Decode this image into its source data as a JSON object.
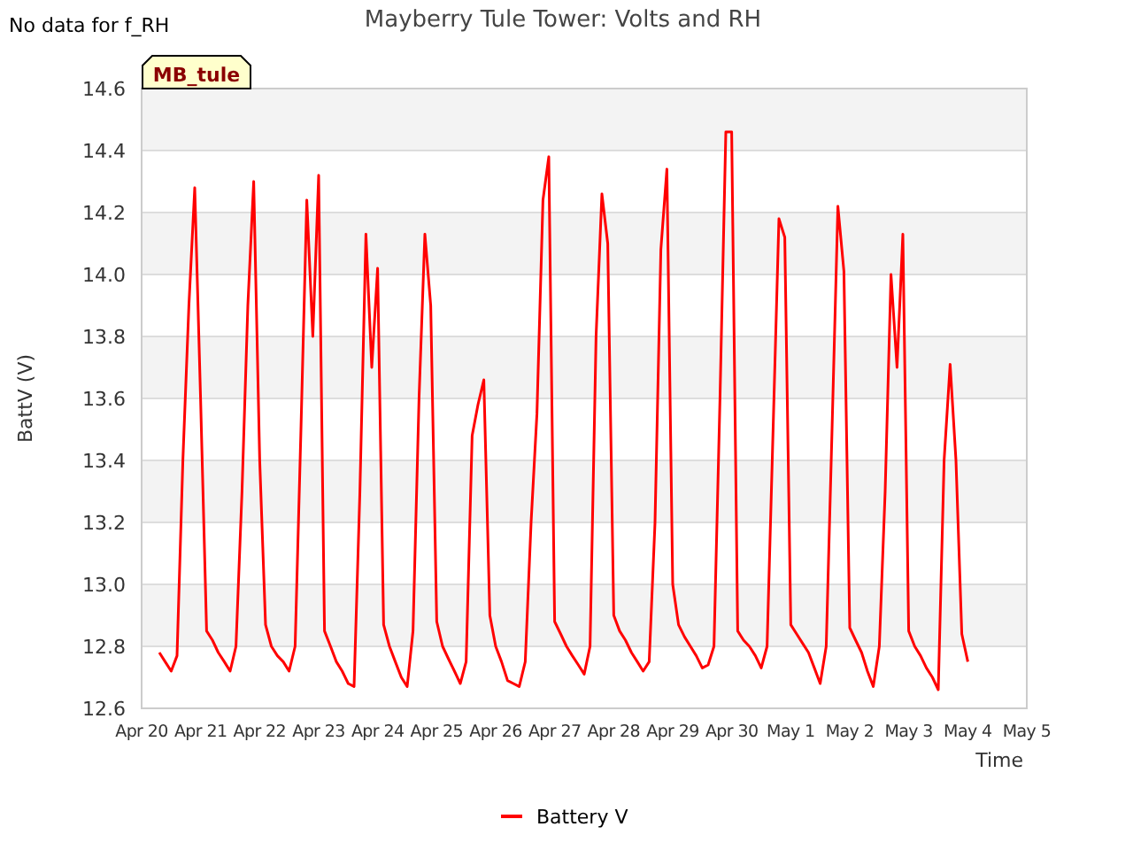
{
  "note": "No data for f_RH",
  "site_tag": "MB_tule",
  "chart_data": {
    "type": "line",
    "title": "Mayberry Tule Tower: Volts and RH",
    "xlabel": "Time",
    "ylabel": "BattV (V)",
    "categories": [
      "Apr 20",
      null,
      null,
      null,
      null,
      null,
      null,
      null,
      null,
      null,
      "Apr 21",
      null,
      null,
      null,
      null,
      null,
      null,
      null,
      null,
      null,
      "Apr 22",
      null,
      null,
      null,
      null,
      null,
      null,
      null,
      null,
      null,
      "Apr 23",
      null,
      null,
      null,
      null,
      null,
      null,
      null,
      null,
      null,
      "Apr 24",
      null,
      null,
      null,
      null,
      null,
      null,
      null,
      null,
      null,
      "Apr 25",
      null,
      null,
      null,
      null,
      null,
      null,
      null,
      null,
      null,
      "Apr 26",
      null,
      null,
      null,
      null,
      null,
      null,
      null,
      null,
      null,
      "Apr 27",
      null,
      null,
      null,
      null,
      null,
      null,
      null,
      null,
      null,
      "Apr 28",
      null,
      null,
      null,
      null,
      null,
      null,
      null,
      null,
      null,
      "Apr 29",
      null,
      null,
      null,
      null,
      null,
      null,
      null,
      null,
      null,
      "Apr 30",
      null,
      null,
      null,
      null,
      null,
      null,
      null,
      null,
      null,
      "May 1",
      null,
      null,
      null,
      null,
      null,
      null,
      null,
      null,
      null,
      "May 2",
      null,
      null,
      null,
      null,
      null,
      null,
      null,
      null,
      null,
      "May 3",
      null,
      null,
      null,
      null,
      null,
      null,
      null,
      null,
      null,
      "May 4",
      null,
      null,
      null,
      null,
      null,
      null,
      null,
      null,
      null,
      "May 5"
    ],
    "series": [
      {
        "name": "Battery V",
        "color": "#ff0000",
        "values": [
          null,
          null,
          null,
          12.78,
          12.75,
          12.72,
          12.77,
          13.4,
          13.9,
          14.28,
          13.6,
          12.85,
          12.82,
          12.78,
          12.75,
          12.72,
          12.8,
          13.3,
          13.9,
          14.3,
          13.4,
          12.87,
          12.8,
          12.77,
          12.75,
          12.72,
          12.8,
          13.5,
          14.24,
          13.8,
          14.32,
          12.85,
          12.8,
          12.75,
          12.72,
          12.68,
          12.67,
          13.3,
          14.13,
          13.7,
          14.02,
          12.87,
          12.8,
          12.75,
          12.7,
          12.67,
          12.85,
          13.6,
          14.13,
          13.9,
          12.88,
          12.8,
          12.76,
          12.72,
          12.68,
          12.75,
          13.48,
          13.58,
          13.66,
          12.9,
          12.8,
          12.75,
          12.69,
          12.68,
          12.67,
          12.75,
          13.2,
          13.55,
          14.24,
          14.38,
          12.88,
          12.84,
          12.8,
          12.77,
          12.74,
          12.71,
          12.8,
          13.8,
          14.26,
          14.1,
          12.9,
          12.85,
          12.82,
          12.78,
          12.75,
          12.72,
          12.75,
          13.2,
          14.08,
          14.34,
          13.0,
          12.87,
          12.83,
          12.8,
          12.77,
          12.73,
          12.74,
          12.8,
          13.6,
          14.46,
          14.46,
          12.85,
          12.82,
          12.8,
          12.77,
          12.73,
          12.8,
          13.5,
          14.18,
          14.12,
          12.87,
          12.84,
          12.81,
          12.78,
          12.73,
          12.68,
          12.8,
          13.5,
          14.22,
          14.01,
          12.86,
          12.82,
          12.78,
          12.72,
          12.67,
          12.8,
          13.3,
          14.0,
          13.7,
          14.13,
          12.85,
          12.8,
          12.77,
          12.73,
          12.7,
          12.66,
          13.4,
          13.71,
          13.4,
          12.84,
          12.75,
          null,
          null,
          null,
          null,
          null,
          null,
          null,
          null,
          null,
          null
        ]
      }
    ],
    "grid": true,
    "ylim": [
      12.6,
      14.6
    ],
    "yticks": [
      {
        "value": 12.6,
        "label": "12.6"
      },
      {
        "value": 12.8,
        "label": "12.8"
      },
      {
        "value": 13.0,
        "label": "13.0"
      },
      {
        "value": 13.2,
        "label": "13.2"
      },
      {
        "value": 13.4,
        "label": "13.4"
      },
      {
        "value": 13.6,
        "label": "13.6"
      },
      {
        "value": 13.8,
        "label": "13.8"
      },
      {
        "value": 14.0,
        "label": "14.0"
      },
      {
        "value": 14.2,
        "label": "14.2"
      },
      {
        "value": 14.4,
        "label": "14.4"
      },
      {
        "value": 14.6,
        "label": "14.6"
      }
    ]
  }
}
